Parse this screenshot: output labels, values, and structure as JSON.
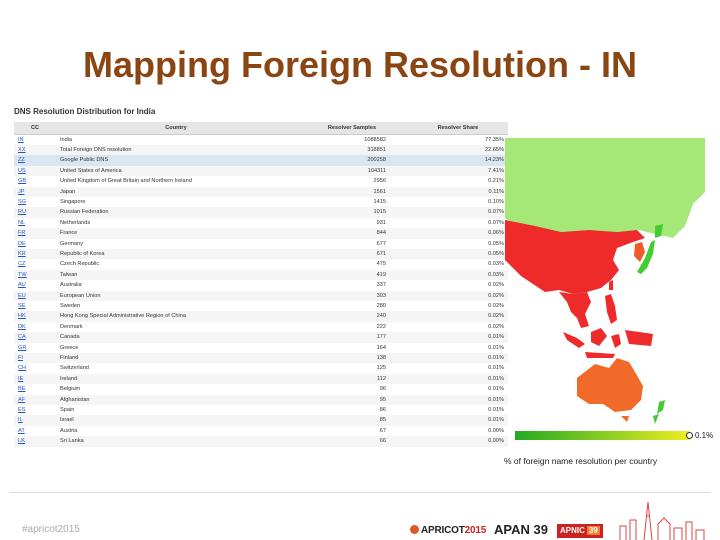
{
  "slide": {
    "title": "Mapping Foreign Resolution - IN"
  },
  "panel": {
    "title": "DNS Resolution Distribution for India",
    "headers": {
      "cc": "CC",
      "country": "Country",
      "samples": "Resolver Samples",
      "share": "Resolver Share"
    },
    "rows": [
      {
        "cc": "IN",
        "country": "India",
        "samples": "1088582",
        "share": "77.35%"
      },
      {
        "cc": "XX",
        "country": "Total Foreign DNS resolution",
        "samples": "318851",
        "share": "22.65%"
      },
      {
        "cc": "ZZ",
        "country": "Google Public DNS",
        "samples": "200258",
        "share": "14.23%"
      },
      {
        "cc": "US",
        "country": "United States of America",
        "samples": "104311",
        "share": "7.41%"
      },
      {
        "cc": "GB",
        "country": "United Kingdom of Great Britain and Northern Ireland",
        "samples": "2956",
        "share": "0.21%"
      },
      {
        "cc": "JP",
        "country": "Japan",
        "samples": "1561",
        "share": "0.11%"
      },
      {
        "cc": "SG",
        "country": "Singapore",
        "samples": "1415",
        "share": "0.10%"
      },
      {
        "cc": "RU",
        "country": "Russian Federation",
        "samples": "1015",
        "share": "0.07%"
      },
      {
        "cc": "NL",
        "country": "Netherlands",
        "samples": "931",
        "share": "0.07%"
      },
      {
        "cc": "FR",
        "country": "France",
        "samples": "844",
        "share": "0.06%"
      },
      {
        "cc": "DE",
        "country": "Germany",
        "samples": "677",
        "share": "0.05%"
      },
      {
        "cc": "KR",
        "country": "Republic of Korea",
        "samples": "671",
        "share": "0.05%"
      },
      {
        "cc": "CZ",
        "country": "Czech Republic",
        "samples": "475",
        "share": "0.03%"
      },
      {
        "cc": "TW",
        "country": "Taiwan",
        "samples": "419",
        "share": "0.03%"
      },
      {
        "cc": "AU",
        "country": "Australia",
        "samples": "337",
        "share": "0.02%"
      },
      {
        "cc": "EU",
        "country": "European Union",
        "samples": "303",
        "share": "0.02%"
      },
      {
        "cc": "SE",
        "country": "Sweden",
        "samples": "280",
        "share": "0.02%"
      },
      {
        "cc": "HK",
        "country": "Hong Kong Special Administrative Region of China",
        "samples": "240",
        "share": "0.02%"
      },
      {
        "cc": "DK",
        "country": "Denmark",
        "samples": "222",
        "share": "0.02%"
      },
      {
        "cc": "CA",
        "country": "Canada",
        "samples": "177",
        "share": "0.01%"
      },
      {
        "cc": "GR",
        "country": "Greece",
        "samples": "164",
        "share": "0.01%"
      },
      {
        "cc": "FI",
        "country": "Finland",
        "samples": "138",
        "share": "0.01%"
      },
      {
        "cc": "CH",
        "country": "Switzerland",
        "samples": "125",
        "share": "0.01%"
      },
      {
        "cc": "IE",
        "country": "Ireland",
        "samples": "112",
        "share": "0.01%"
      },
      {
        "cc": "BE",
        "country": "Belgium",
        "samples": "96",
        "share": "0.01%"
      },
      {
        "cc": "AF",
        "country": "Afghanistan",
        "samples": "95",
        "share": "0.01%"
      },
      {
        "cc": "ES",
        "country": "Spain",
        "samples": "86",
        "share": "0.01%"
      },
      {
        "cc": "IL",
        "country": "Israel",
        "samples": "85",
        "share": "0.01%"
      },
      {
        "cc": "AT",
        "country": "Austria",
        "samples": "67",
        "share": "0.00%"
      },
      {
        "cc": "LK",
        "country": "Sri Lanka",
        "samples": "66",
        "share": "0.00%"
      }
    ],
    "highlight_row_index": 2
  },
  "map": {
    "colors": {
      "russia": "#a6e878",
      "china": "#ee2a2a",
      "southeast_asia": "#ee2a2a",
      "australia": "#f26a2a",
      "japan": "#44cc33",
      "korea": "#ee5a2a",
      "background": "#ffffff"
    }
  },
  "legend": {
    "value_label": "0.1%",
    "caption": "% of foreign name resolution per country",
    "gradient_start": "#22aa22",
    "gradient_end": "#eeee22"
  },
  "footer": {
    "hashtag": "#apricot2015",
    "apricot_brand": "APRICOT",
    "apricot_year": "2015",
    "apan_label": "APAN 39",
    "apnic_label": "APNIC",
    "apnic_number": "39"
  }
}
